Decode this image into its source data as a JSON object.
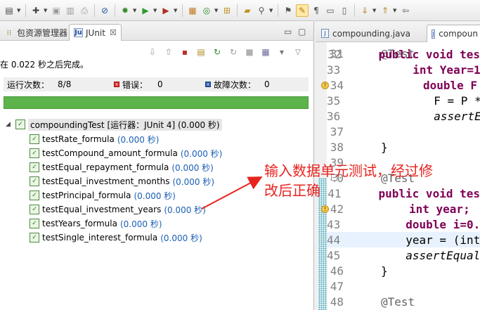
{
  "toolbar": {
    "icons": [
      "new-icon",
      "new-wizard-icon",
      "save-icon",
      "save-all-icon",
      "print-icon",
      "skip-breakpoints-icon",
      "debug-icon",
      "run-icon",
      "run-external-icon",
      "new-java-project-icon",
      "new-class-icon",
      "open-type-icon",
      "search-icon",
      "toggle-mark-occurrences-icon",
      "highlight-icon",
      "show-whitespace-icon",
      "block-selection-icon",
      "next-annotation-icon",
      "prev-annotation-icon",
      "back-icon"
    ]
  },
  "left_view": {
    "tabs": [
      {
        "label": "包资源管理器"
      },
      {
        "label": "JUnit"
      }
    ],
    "finished_message": "在 0.022 秒之后完成。",
    "counters": {
      "runs_label": "运行次数：",
      "runs_value": "8/8",
      "errors_label": "错误：",
      "errors_value": "0",
      "failures_label": "故障次数：",
      "failures_value": "0"
    },
    "progress": 1.0,
    "progress_color": "#5bb34a",
    "root": {
      "name": "compoundingTest",
      "runner": "[运行器：JUnit 4]",
      "time": "(0.000 秒)"
    },
    "tests": [
      {
        "name": "testRate_formula",
        "time": "(0.000 秒)"
      },
      {
        "name": "testCompound_amount_formula",
        "time": "(0.000 秒)"
      },
      {
        "name": "testEqual_repayment_formula",
        "time": "(0.000 秒)"
      },
      {
        "name": "testEqual_investment_months",
        "time": "(0.000 秒)"
      },
      {
        "name": "testPrincipal_formula",
        "time": "(0.000 秒)"
      },
      {
        "name": "testEqual_investment_years",
        "time": "(0.000 秒)"
      },
      {
        "name": "testYears_formula",
        "time": "(0.000 秒)"
      },
      {
        "name": "testSingle_interest_formula",
        "time": "(0.000 秒)"
      }
    ]
  },
  "annotation": {
    "line1": "输入数据单元测试，经过修",
    "line2": "改后正确",
    "color": "#e8231e"
  },
  "editor": {
    "tabs": [
      {
        "label": "compounding.java"
      },
      {
        "label": "compoun"
      }
    ],
    "lines": [
      {
        "num": "31",
        "code": "@Test"
      },
      {
        "num": "32",
        "code": "public void tes"
      },
      {
        "num": "33",
        "code": "int Year=1"
      },
      {
        "num": "34",
        "code": "double F"
      },
      {
        "num": "35",
        "code": "F = P *"
      },
      {
        "num": "36",
        "code": "assertE"
      },
      {
        "num": "37",
        "code": ""
      },
      {
        "num": "38",
        "code": "}"
      },
      {
        "num": "39",
        "code": ""
      },
      {
        "num": "40",
        "code": "@Test"
      },
      {
        "num": "41",
        "code": "public void tes"
      },
      {
        "num": "42",
        "code": "int year;"
      },
      {
        "num": "43",
        "code": "double i=0."
      },
      {
        "num": "44",
        "code": "year = (int"
      },
      {
        "num": "45",
        "code": "assertEqual"
      },
      {
        "num": "46",
        "code": "}"
      },
      {
        "num": "47",
        "code": ""
      },
      {
        "num": "48",
        "code": "@Test"
      }
    ]
  }
}
